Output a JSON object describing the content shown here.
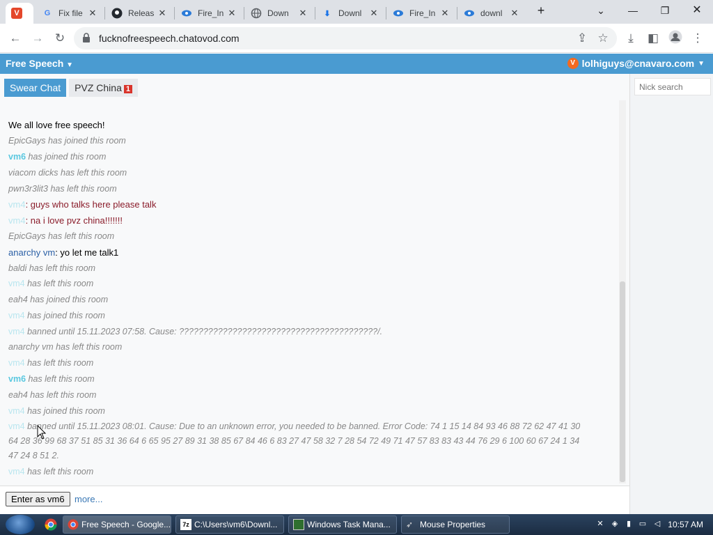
{
  "browser": {
    "tabs": [
      {
        "title": "",
        "icon": "vivaldi-v-icon"
      },
      {
        "title": "Fix file",
        "icon": "google-icon"
      },
      {
        "title": "Releas",
        "icon": "github-icon"
      },
      {
        "title": "Fire_In",
        "icon": "blue-swirl-icon"
      },
      {
        "title": "Down",
        "icon": "globe-icon"
      },
      {
        "title": "Downl",
        "icon": "download-icon"
      },
      {
        "title": "Fire_In",
        "icon": "blue-swirl-icon"
      },
      {
        "title": "downl",
        "icon": "blue-swirl-icon"
      }
    ],
    "new_tab_glyph": "+",
    "url": "fucknofreespeech.chatovod.com"
  },
  "app": {
    "brand": "Free Speech",
    "user": "lolhiguys@cnavaro.com",
    "rooms": [
      {
        "label": "Swear Chat",
        "active": true
      },
      {
        "label": "PVZ China",
        "badge": "1",
        "active": false
      }
    ],
    "nick_search_placeholder": "Nick search",
    "enter_label": "Enter as vm6",
    "more_label": "more..."
  },
  "messages": [
    {
      "text": "We all love free speech!"
    },
    {
      "nick": "",
      "text": "EpicGays has joined this room"
    },
    {
      "nick": "vm6",
      "text": " has joined this room"
    },
    {
      "nick": "",
      "text": "viacom dicks has left this room"
    },
    {
      "nick": "",
      "text": "pwn3r3lit3 has left this room"
    },
    {
      "nick": "vm4",
      "text": ": guys who talks here please talk"
    },
    {
      "nick": "vm4",
      "text": ": na i love pvz china!!!!!!!"
    },
    {
      "nick": "",
      "text": "EpicGays has left this room"
    },
    {
      "nick": "anarchy vm",
      "text": ": yo let me talk1"
    },
    {
      "nick": "",
      "text": "baldi has left this room"
    },
    {
      "nick": "vm4",
      "text": " has left this room"
    },
    {
      "nick": "",
      "text": "eah4 has joined this room"
    },
    {
      "nick": "vm4",
      "text": " has joined this room"
    },
    {
      "nick": "vm4",
      "text": " banned until 15.11.2023 07:58. Cause: ?????????????????????????????????????????/."
    },
    {
      "nick": "",
      "text": "anarchy vm has left this room"
    },
    {
      "nick": "vm4",
      "text": " has left this room"
    },
    {
      "nick": "vm6",
      "text": " has left this room"
    },
    {
      "nick": "",
      "text": "eah4 has left this room"
    },
    {
      "nick": "vm4",
      "text": " has joined this room"
    },
    {
      "nick": "vm4",
      "text": " banned until 15.11.2023 08:01. Cause: Due to an unknown error, you needed to be banned. Error Code: 74 1 15 14 84 93 46 88 72 62 47 41 30 64 28 36 99 68 37 51 85 31 36 64 6 65 95 27 89 31 38 85 67 84 46 6 83 27 47 58 32 7 28 54 72 49 71 47 57 83 83 43 44 76 29 6 100 60 67 24 1 34 47 24 8 51 2."
    },
    {
      "nick": "vm4",
      "text": " has left this room"
    }
  ],
  "taskbar": {
    "items": [
      {
        "label": "Free Speech - Google...",
        "icon": "chrome-icon"
      },
      {
        "label": "C:\\Users\\vm6\\Downl...",
        "icon": "7zip-icon"
      },
      {
        "label": "Windows Task Mana...",
        "icon": "task-manager-icon"
      },
      {
        "label": "Mouse Properties",
        "icon": "mouse-icon"
      }
    ],
    "clock": "10:57 AM"
  },
  "colors": {
    "app_bar": "#4a9bd1",
    "nick_cyan": "#5bc8e0",
    "nick_anarchy": "#2a5fa5",
    "message_red": "#8a1c2a"
  }
}
